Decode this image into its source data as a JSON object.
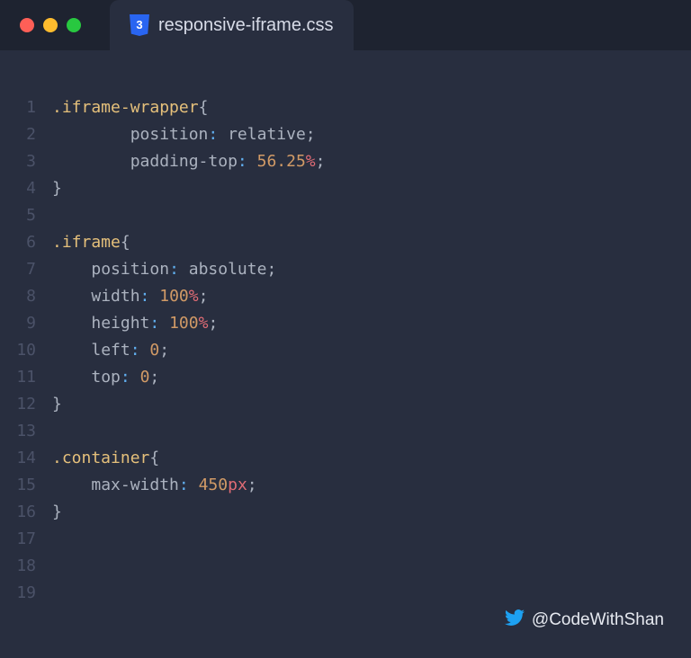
{
  "tab": {
    "title": "responsive-iframe.css"
  },
  "lines": [
    {
      "num": "1",
      "indent": 0,
      "type": "selector-open",
      "selector": ".iframe-wrapper"
    },
    {
      "num": "2",
      "indent": 2,
      "type": "declaration",
      "property": "position",
      "value": "relative",
      "valueKind": "plain"
    },
    {
      "num": "3",
      "indent": 2,
      "type": "declaration",
      "property": "padding-top",
      "value": "56.25",
      "valueKind": "number",
      "unit": "%"
    },
    {
      "num": "4",
      "indent": 0,
      "type": "close"
    },
    {
      "num": "5",
      "indent": 0,
      "type": "blank"
    },
    {
      "num": "6",
      "indent": 0,
      "type": "selector-open",
      "selector": ".iframe"
    },
    {
      "num": "7",
      "indent": 1,
      "type": "declaration",
      "property": "position",
      "value": "absolute",
      "valueKind": "plain"
    },
    {
      "num": "8",
      "indent": 1,
      "type": "declaration",
      "property": "width",
      "value": "100",
      "valueKind": "number",
      "unit": "%"
    },
    {
      "num": "9",
      "indent": 1,
      "type": "declaration",
      "property": "height",
      "value": "100",
      "valueKind": "number",
      "unit": "%"
    },
    {
      "num": "10",
      "indent": 1,
      "type": "declaration",
      "property": "left",
      "value": "0",
      "valueKind": "number"
    },
    {
      "num": "11",
      "indent": 1,
      "type": "declaration",
      "property": "top",
      "value": "0",
      "valueKind": "number"
    },
    {
      "num": "12",
      "indent": 0,
      "type": "close"
    },
    {
      "num": "13",
      "indent": 0,
      "type": "blank"
    },
    {
      "num": "14",
      "indent": 0,
      "type": "selector-open",
      "selector": ".container"
    },
    {
      "num": "15",
      "indent": 1,
      "type": "declaration",
      "property": "max-width",
      "value": "450",
      "valueKind": "number",
      "unit": "px"
    },
    {
      "num": "16",
      "indent": 0,
      "type": "close"
    },
    {
      "num": "17",
      "indent": 0,
      "type": "blank"
    },
    {
      "num": "18",
      "indent": 0,
      "type": "blank"
    },
    {
      "num": "19",
      "indent": 0,
      "type": "blank"
    }
  ],
  "footer": {
    "handle": "@CodeWithShan"
  }
}
